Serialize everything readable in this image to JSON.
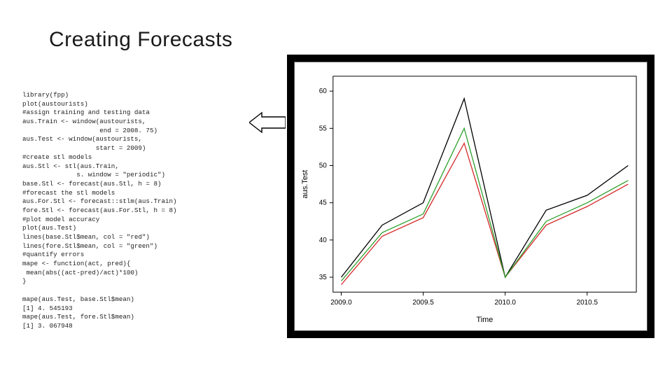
{
  "title": "Creating Forecasts",
  "code": {
    "l1": "library(fpp)",
    "l2": "plot(austourists)",
    "l3": "#assign training and testing data",
    "l4": "aus.Train <- window(austourists,",
    "l5": "                    end = 2008. 75)",
    "l6": "aus.Test <- window(austourists,",
    "l7": "                   start = 2009)",
    "l8": "#create stl models",
    "l9": "aus.Stl <- stl(aus.Train,",
    "l10": "              s. window = \"periodic\")",
    "l11": "base.Stl <- forecast(aus.Stl, h = 8)",
    "l12": "#forecast the stl models",
    "l13": "aus.For.Stl <- forecast::stlm(aus.Train)",
    "l14": "fore.Stl <- forecast(aus.For.Stl, h = 8)",
    "l15": "#plot model accuracy",
    "l16": "plot(aus.Test)",
    "l17": "lines(base.Stl$mean, col = \"red\")",
    "l18": "lines(fore.Stl$mean, col = \"green\")",
    "l19": "#quantify errors",
    "l20": "mape <- function(act, pred){",
    "l21": " mean(abs((act-pred)/act)*100)",
    "l22": "}",
    "l23": "",
    "l24": "mape(aus.Test, base.Stl$mean)",
    "l25": "[1] 4. 545193",
    "l26": "mape(aus.Test, fore.Stl$mean)",
    "l27": "[1] 3. 067948"
  },
  "chart_data": {
    "type": "line",
    "title": "",
    "xlabel": "Time",
    "ylabel": "aus.Test",
    "x_ticks": [
      "2009.0",
      "2009.5",
      "2010.0",
      "2010.5"
    ],
    "y_ticks": [
      "35",
      "40",
      "45",
      "50",
      "55",
      "60"
    ],
    "xlim": [
      2008.95,
      2010.8
    ],
    "ylim": [
      33,
      62
    ],
    "series": [
      {
        "name": "aus.Test",
        "color": "#000000",
        "x": [
          2009.0,
          2009.25,
          2009.5,
          2009.75,
          2010.0,
          2010.25,
          2010.5,
          2010.75
        ],
        "values": [
          35,
          42,
          45,
          59,
          35,
          44,
          46,
          50
        ]
      },
      {
        "name": "base.Stl$mean",
        "color": "#d62728",
        "x": [
          2009.0,
          2009.25,
          2009.5,
          2009.75,
          2010.0,
          2010.25,
          2010.5,
          2010.75
        ],
        "values": [
          34,
          40.5,
          43,
          53,
          35,
          42,
          44.5,
          47.5
        ]
      },
      {
        "name": "fore.Stl$mean",
        "color": "#2ca02c",
        "x": [
          2009.0,
          2009.25,
          2009.5,
          2009.75,
          2010.0,
          2010.25,
          2010.5,
          2010.75
        ],
        "values": [
          34.5,
          41,
          43.5,
          55,
          35,
          42.5,
          45,
          48
        ]
      }
    ]
  },
  "colors": {
    "callout_fill": "#ffffff",
    "callout_stroke": "#000000"
  }
}
